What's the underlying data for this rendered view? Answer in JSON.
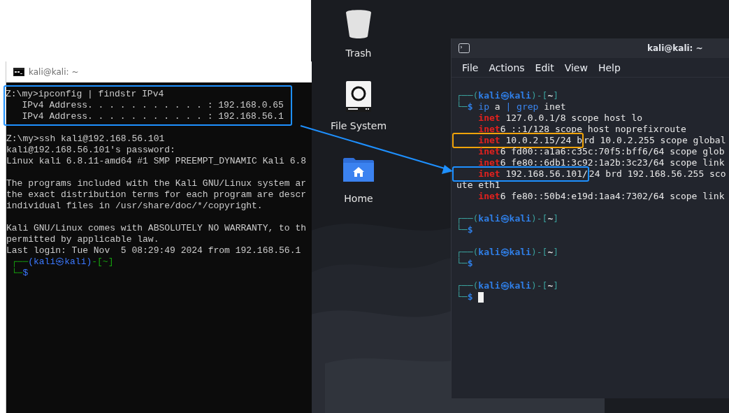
{
  "cmd_window": {
    "title": "kali@kali: ~",
    "blocks": [
      {
        "color": "#1e90ff",
        "lines": [
          {
            "segments": [
              {
                "text": "Z:\\my>ipconfig | findstr IPv4",
                "kind": "plain"
              }
            ]
          },
          {
            "segments": [
              {
                "text": "   IPv4 Address. . . . . . . . . . . : 192.168.0.65",
                "kind": "plain"
              }
            ]
          },
          {
            "segments": [
              {
                "text": "   IPv4 Address. . . . . . . . . . . : 192.168.56.1",
                "kind": "plain"
              }
            ]
          }
        ]
      },
      {
        "lines": [
          {
            "segments": [
              {
                "text": "Z:\\my>ssh kali@192.168.56.101",
                "kind": "plain"
              }
            ]
          },
          {
            "segments": [
              {
                "text": "kali@192.168.56.101's password:",
                "kind": "plain"
              }
            ]
          },
          {
            "segments": [
              {
                "text": "Linux kali 6.8.11-amd64 #1 SMP PREEMPT_DYNAMIC Kali 6.8",
                "kind": "plain"
              }
            ]
          }
        ]
      },
      {
        "lines": [
          {
            "segments": [
              {
                "text": "The programs included with the Kali GNU/Linux system ar",
                "kind": "plain"
              }
            ]
          },
          {
            "segments": [
              {
                "text": "the exact distribution terms for each program are descr",
                "kind": "plain"
              }
            ]
          },
          {
            "segments": [
              {
                "text": "individual files in /usr/share/doc/*/copyright.",
                "kind": "plain"
              }
            ]
          }
        ]
      },
      {
        "lines": [
          {
            "segments": [
              {
                "text": "Kali GNU/Linux comes with ABSOLUTELY NO WARRANTY, to th",
                "kind": "plain"
              }
            ]
          },
          {
            "segments": [
              {
                "text": "permitted by applicable law.",
                "kind": "plain"
              }
            ]
          },
          {
            "segments": [
              {
                "text": "Last login: Tue Nov  5 08:29:49 2024 from 192.168.56.1",
                "kind": "plain"
              }
            ]
          },
          {
            "segments": [
              {
                "text": " ┌──",
                "kind": "frame"
              },
              {
                "text": "(kali㉿kali)",
                "kind": "user"
              },
              {
                "text": "-[~]",
                "kind": "frame"
              }
            ]
          },
          {
            "segments": [
              {
                "text": " └─",
                "kind": "frame"
              },
              {
                "text": "$",
                "kind": "user"
              }
            ]
          }
        ]
      }
    ]
  },
  "desktop": {
    "icons": [
      {
        "label": "Trash",
        "kind": "trash"
      },
      {
        "label": "File System",
        "kind": "drive"
      },
      {
        "label": "Home",
        "kind": "home"
      }
    ]
  },
  "kali_terminal": {
    "title": "kali@kali: ~",
    "menu": [
      "File",
      "Actions",
      "Edit",
      "View",
      "Help"
    ],
    "blocks": [
      {
        "lines": [
          {
            "segments": [
              {
                "text": "┌──(",
                "kind": "frame"
              },
              {
                "text": "kali㉿kali",
                "kind": "user"
              },
              {
                "text": ")-[",
                "kind": "frame"
              },
              {
                "text": "~",
                "kind": "bold"
              },
              {
                "text": "]",
                "kind": "frame"
              }
            ]
          },
          {
            "segments": [
              {
                "text": "└─",
                "kind": "frame"
              },
              {
                "text": "$ ",
                "kind": "user"
              },
              {
                "text": "ip",
                "kind": "cmd"
              },
              {
                "text": " a ",
                "kind": "plain"
              },
              {
                "text": "|",
                "kind": "cmd"
              },
              {
                "text": " grep",
                "kind": "cmd"
              },
              {
                "text": " inet",
                "kind": "plain"
              }
            ]
          },
          {
            "segments": [
              {
                "text": "    inet",
                "kind": "red"
              },
              {
                "text": " 127.0.0.1/8 scope host lo",
                "kind": "plain"
              }
            ]
          },
          {
            "segments": [
              {
                "text": "    inet",
                "kind": "red"
              },
              {
                "text": "6 ::1/128 scope host noprefixroute",
                "kind": "plain"
              }
            ]
          },
          {
            "color": "#f0a30a",
            "boxed": [
              {
                "text": "    inet",
                "kind": "red"
              },
              {
                "text": " 10.0.2.15/24 b",
                "kind": "plain"
              }
            ],
            "segments": [
              {
                "text": "rd 10.0.2.255 scope global",
                "kind": "plain"
              }
            ]
          },
          {
            "segments": [
              {
                "text": "    inet",
                "kind": "red"
              },
              {
                "text": "6 fd00::a1a6:c35c:70f5:bff6/64 scope glob",
                "kind": "plain"
              }
            ]
          },
          {
            "segments": [
              {
                "text": "    inet",
                "kind": "red"
              },
              {
                "text": "6 fe80::6db1:3c92:1a2b:3c23/64 scope link",
                "kind": "plain"
              }
            ]
          },
          {
            "color": "#1e90ff",
            "boxed": [
              {
                "text": "    inet",
                "kind": "red"
              },
              {
                "text": " 192.168.56.101/",
                "kind": "plain"
              }
            ],
            "segments": [
              {
                "text": "24 brd 192.168.56.255 sco",
                "kind": "plain"
              }
            ]
          },
          {
            "segments": [
              {
                "text": "ute eth1",
                "kind": "plain"
              }
            ]
          },
          {
            "segments": [
              {
                "text": "    inet",
                "kind": "red"
              },
              {
                "text": "6 fe80::50b4:e19d:1aa4:7302/64 scope link",
                "kind": "plain"
              }
            ]
          }
        ]
      },
      {
        "lines": [
          {
            "segments": [
              {
                "text": "┌──(",
                "kind": "frame"
              },
              {
                "text": "kali㉿kali",
                "kind": "user"
              },
              {
                "text": ")-[",
                "kind": "frame"
              },
              {
                "text": "~",
                "kind": "bold"
              },
              {
                "text": "]",
                "kind": "frame"
              }
            ]
          },
          {
            "segments": [
              {
                "text": "└─",
                "kind": "frame"
              },
              {
                "text": "$",
                "kind": "user"
              }
            ]
          }
        ]
      },
      {
        "lines": [
          {
            "segments": [
              {
                "text": "┌──(",
                "kind": "frame"
              },
              {
                "text": "kali㉿kali",
                "kind": "user"
              },
              {
                "text": ")-[",
                "kind": "frame"
              },
              {
                "text": "~",
                "kind": "bold"
              },
              {
                "text": "]",
                "kind": "frame"
              }
            ]
          },
          {
            "segments": [
              {
                "text": "└─",
                "kind": "frame"
              },
              {
                "text": "$",
                "kind": "user"
              }
            ]
          }
        ]
      },
      {
        "lines": [
          {
            "segments": [
              {
                "text": "┌──(",
                "kind": "frame"
              },
              {
                "text": "kali㉿kali",
                "kind": "user"
              },
              {
                "text": ")-[",
                "kind": "frame"
              },
              {
                "text": "~",
                "kind": "bold"
              },
              {
                "text": "]",
                "kind": "frame"
              }
            ]
          },
          {
            "segments": [
              {
                "text": "└─",
                "kind": "frame"
              },
              {
                "text": "$",
                "kind": "user"
              }
            ],
            "cursor": true
          }
        ]
      }
    ]
  }
}
